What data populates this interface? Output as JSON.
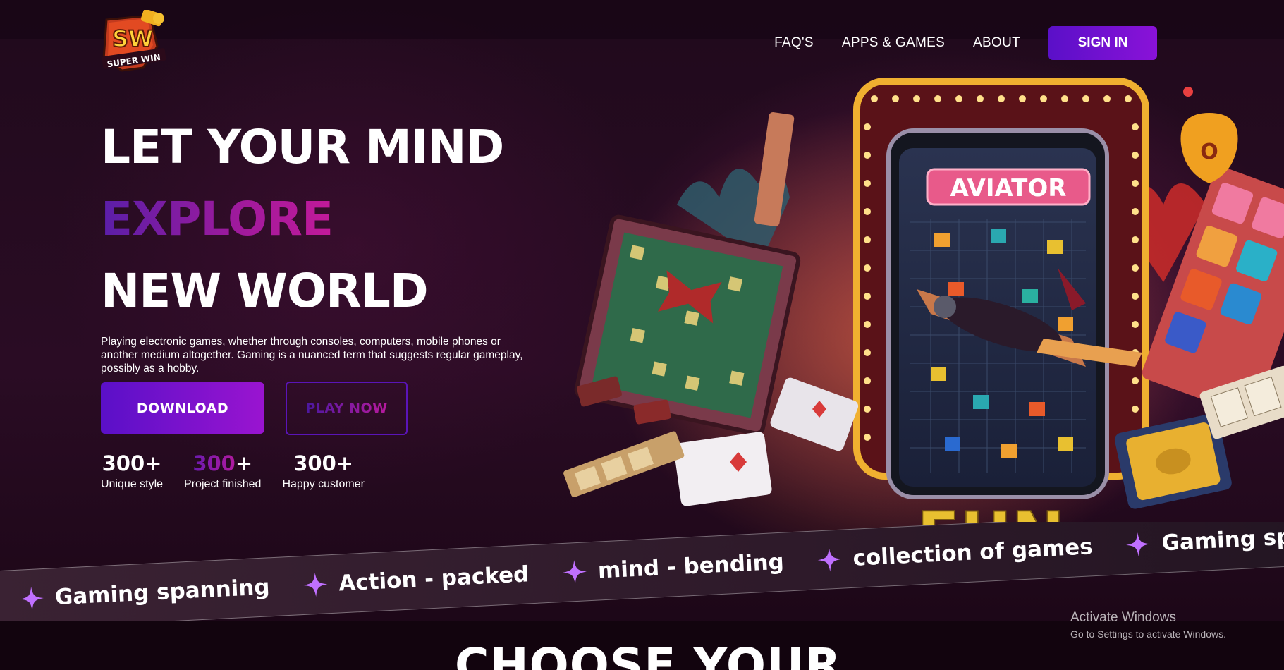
{
  "brand": {
    "logo_text_top": "SW",
    "logo_text_bottom": "SUPER WIN"
  },
  "nav": {
    "items": [
      "FAQ'S",
      "APPS & GAMES",
      "ABOUT"
    ],
    "sign_in": "SIGN IN"
  },
  "hero": {
    "line1": "LET YOUR MIND",
    "line2": "EXPLORE",
    "line3": "NEW WORLD",
    "description": "Playing electronic games, whether through consoles, computers, mobile phones or another medium altogether. Gaming is a nuanced term that suggests regular gameplay, possibly as a hobby.",
    "download_label": "DOWNLOAD",
    "play_label": "PLAY NOW"
  },
  "stats": [
    {
      "num_main": "300",
      "num_suffix": "+",
      "label": "Unique style"
    },
    {
      "num_main": "300",
      "num_suffix": "+",
      "label": "Project finished"
    },
    {
      "num_main": "300",
      "num_suffix": "+",
      "label": "Happy customer"
    }
  ],
  "art": {
    "aviator_label": "AVIATOR",
    "fun_label": "FUN",
    "sign_o": "O"
  },
  "marquee": [
    "Gaming spanning",
    "Action - packed",
    "mind - bending",
    "collection of games",
    "Gaming spanning"
  ],
  "section_title": "CHOOSE YOUR",
  "watermark": {
    "title": "Activate Windows",
    "subtitle": "Go to Settings to activate Windows."
  },
  "colors": {
    "accent_purple": "#6a12d0",
    "accent_pink": "#c21a9a",
    "bg": "#200a1c"
  }
}
